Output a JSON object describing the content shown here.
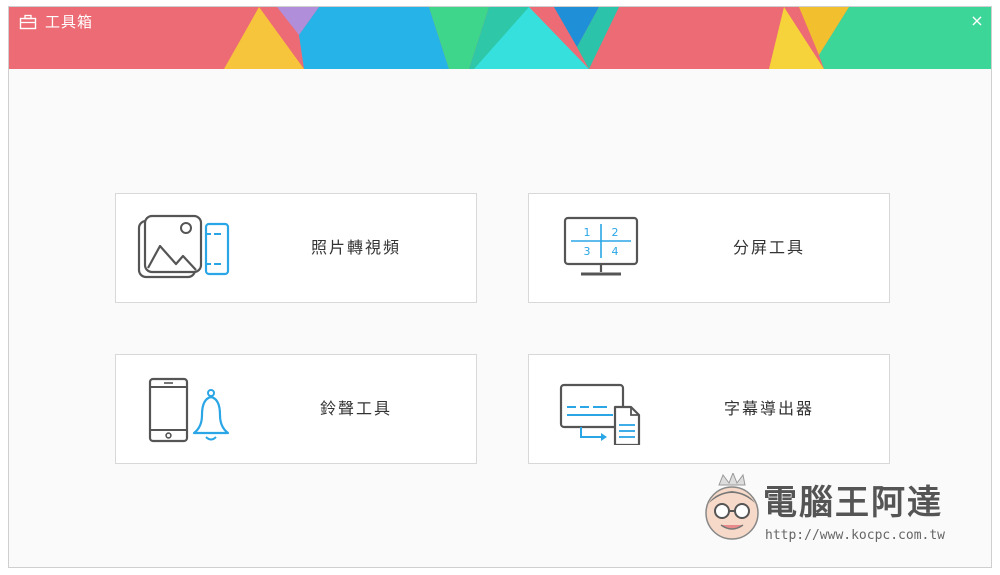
{
  "window": {
    "title": "工具箱",
    "close_label": "×"
  },
  "tools": [
    {
      "label": "照片轉視頻",
      "icon": "photo-to-video-icon"
    },
    {
      "label": "分屏工具",
      "icon": "split-screen-icon"
    },
    {
      "label": "鈴聲工具",
      "icon": "ringtone-icon"
    },
    {
      "label": "字幕導出器",
      "icon": "subtitle-export-icon"
    }
  ],
  "split_screen_icon_numbers": [
    "1",
    "2",
    "3",
    "4"
  ],
  "watermark": {
    "title": "電腦王阿達",
    "url": "http://www.kocpc.com.tw"
  },
  "colors": {
    "accent_blue": "#2aa6e6",
    "icon_dark": "#555555",
    "banner_red": "#ec6b74",
    "banner_teal": "#3dd6b8"
  }
}
